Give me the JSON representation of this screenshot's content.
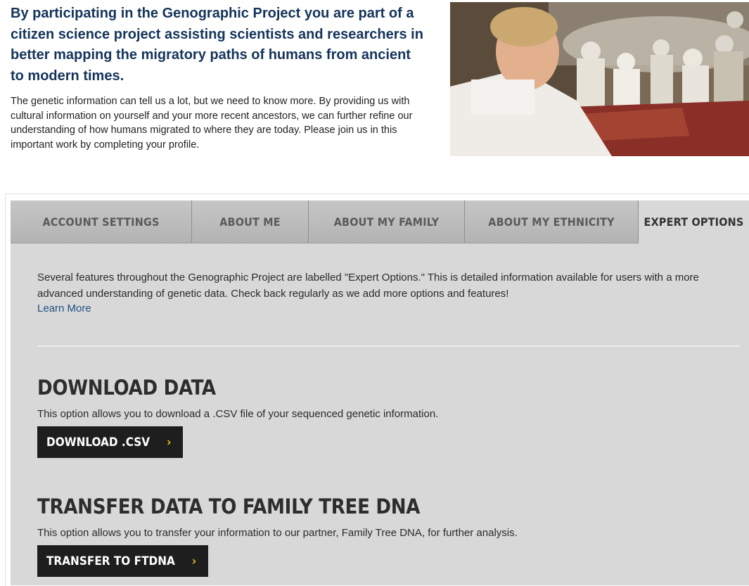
{
  "intro": {
    "heading": "By participating in the Genographic Project you are part of a citizen science project assisting scientists and researchers in better mapping the migratory paths of humans from ancient to modern times.",
    "body": "The genetic information can tell us a lot, but we need to know more. By providing us with cultural information on yourself and your more recent ancestors, we can further refine our understanding of how humans migrated to where they are today. Please join us in this important work by completing your profile."
  },
  "tabs": [
    {
      "label": "ACCOUNT SETTINGS"
    },
    {
      "label": "ABOUT ME"
    },
    {
      "label": "ABOUT MY FAMILY"
    },
    {
      "label": "ABOUT MY ETHNICITY"
    },
    {
      "label": "EXPERT OPTIONS"
    }
  ],
  "expert": {
    "description": "Several features throughout the Genographic Project are labelled \"Expert Options.\" This is detailed information available for users with a more advanced understanding of genetic data. Check back regularly as we add more options and features!",
    "learn_more": "Learn More",
    "download": {
      "title": "DOWNLOAD DATA",
      "desc": "This option allows you to download a .CSV file of your sequenced genetic information.",
      "button": "DOWNLOAD .CSV"
    },
    "transfer": {
      "title": "TRANSFER DATA TO FAMILY TREE DNA",
      "desc": "This option allows you to transfer your information to our partner, Family Tree DNA, for further analysis.",
      "button": "TRANSFER TO FTDNA"
    }
  },
  "colors": {
    "heading": "#14345a",
    "link": "#1f4f82",
    "button_bg": "#1e1e1e",
    "chevron": "#f0c21b",
    "panel_bg": "#d8d8d8"
  },
  "icons": {
    "chevron": "chevron-right-icon"
  }
}
